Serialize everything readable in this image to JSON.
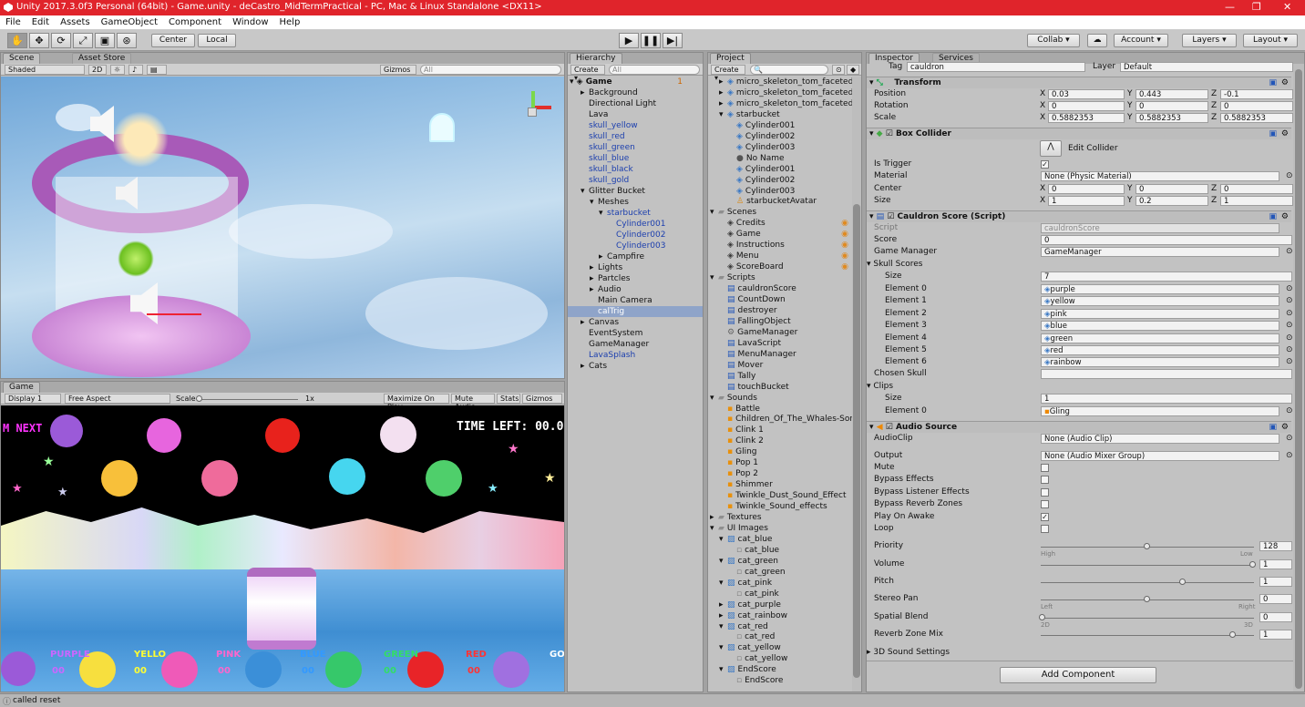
{
  "window": {
    "title": "Unity 2017.3.0f3 Personal (64bit) - Game.unity - deCastro_MidTermPractical - PC, Mac & Linux Standalone <DX11>",
    "accent": "#e0242b"
  },
  "menu": [
    "File",
    "Edit",
    "Assets",
    "GameObject",
    "Component",
    "Window",
    "Help"
  ],
  "toolbar": {
    "center": "Center",
    "local": "Local",
    "collab": "Collab ▾",
    "account": "Account",
    "layers": "Layers",
    "layout": "Layout"
  },
  "scene": {
    "tab": "Scene",
    "tab2": "Asset Store",
    "shading": "Shaded",
    "mode2d": "2D",
    "gizmos": "Gizmos",
    "search": "All"
  },
  "game": {
    "tab": "Game",
    "display": "Display 1",
    "aspect": "Free Aspect",
    "scale_label": "Scale",
    "scale_val": "1x",
    "maximize": "Maximize On Play",
    "mute": "Mute Audio",
    "stats": "Stats",
    "gizmos": "Gizmos",
    "hud_next": "M NEXT",
    "hud_time": "TIME LEFT: 00.0",
    "labels": [
      "PURPLE",
      "YELLO",
      "PINK",
      "BLUE",
      "GREEN",
      "RED",
      "GO"
    ],
    "counts": [
      "00",
      "00",
      "00",
      "00",
      "00",
      "00"
    ]
  },
  "hierarchy": {
    "tab": "Hierarchy",
    "create": "Create",
    "search": "All",
    "root": "Game",
    "badge": "1",
    "items": [
      {
        "t": "Background",
        "ind": 1,
        "arrow": "▸",
        "c": "n"
      },
      {
        "t": "Directional Light",
        "ind": 1,
        "arrow": "",
        "c": "n"
      },
      {
        "t": "Lava",
        "ind": 1,
        "arrow": "",
        "c": "n"
      },
      {
        "t": "skull_yellow",
        "ind": 1,
        "arrow": "",
        "c": "b"
      },
      {
        "t": "skull_red",
        "ind": 1,
        "arrow": "",
        "c": "b"
      },
      {
        "t": "skull_green",
        "ind": 1,
        "arrow": "",
        "c": "b"
      },
      {
        "t": "skull_blue",
        "ind": 1,
        "arrow": "",
        "c": "b"
      },
      {
        "t": "skull_black",
        "ind": 1,
        "arrow": "",
        "c": "b"
      },
      {
        "t": "skull_gold",
        "ind": 1,
        "arrow": "",
        "c": "b"
      },
      {
        "t": "Glitter Bucket",
        "ind": 1,
        "arrow": "▾",
        "c": "n"
      },
      {
        "t": "Meshes",
        "ind": 2,
        "arrow": "▾",
        "c": "n"
      },
      {
        "t": "starbucket",
        "ind": 3,
        "arrow": "▾",
        "c": "b"
      },
      {
        "t": "Cylinder001",
        "ind": 4,
        "arrow": "",
        "c": "b"
      },
      {
        "t": "Cylinder002",
        "ind": 4,
        "arrow": "",
        "c": "b"
      },
      {
        "t": "Cylinder003",
        "ind": 4,
        "arrow": "",
        "c": "b"
      },
      {
        "t": "Campfire",
        "ind": 3,
        "arrow": "▸",
        "c": "n"
      },
      {
        "t": "Lights",
        "ind": 2,
        "arrow": "▸",
        "c": "n"
      },
      {
        "t": "Partcles",
        "ind": 2,
        "arrow": "▸",
        "c": "n"
      },
      {
        "t": "Audio",
        "ind": 2,
        "arrow": "▸",
        "c": "n"
      },
      {
        "t": "Main Camera",
        "ind": 2,
        "arrow": "",
        "c": "n"
      },
      {
        "t": "calTrig",
        "ind": 2,
        "arrow": "",
        "c": "s"
      },
      {
        "t": "Canvas",
        "ind": 1,
        "arrow": "▸",
        "c": "n"
      },
      {
        "t": "EventSystem",
        "ind": 1,
        "arrow": "",
        "c": "n"
      },
      {
        "t": "GameManager",
        "ind": 1,
        "arrow": "",
        "c": "n"
      },
      {
        "t": "LavaSplash",
        "ind": 1,
        "arrow": "",
        "c": "b"
      },
      {
        "t": "Cats",
        "ind": 1,
        "arrow": "▸",
        "c": "n"
      }
    ]
  },
  "project": {
    "tab": "Project",
    "create": "Create",
    "items": [
      {
        "t": "micro_skeleton_tom_faceted_",
        "ind": 1,
        "a": "▸",
        "i": "mesh"
      },
      {
        "t": "micro_skeleton_tom_faceted_",
        "ind": 1,
        "a": "▸",
        "i": "mesh"
      },
      {
        "t": "micro_skeleton_tom_faceted_",
        "ind": 1,
        "a": "▸",
        "i": "mesh"
      },
      {
        "t": "starbucket",
        "ind": 1,
        "a": "▾",
        "i": "mesh"
      },
      {
        "t": "Cylinder001",
        "ind": 2,
        "a": "",
        "i": "mesh"
      },
      {
        "t": "Cylinder002",
        "ind": 2,
        "a": "",
        "i": "mesh"
      },
      {
        "t": "Cylinder003",
        "ind": 2,
        "a": "",
        "i": "mesh"
      },
      {
        "t": "No Name",
        "ind": 2,
        "a": "",
        "i": "mat"
      },
      {
        "t": "Cylinder001",
        "ind": 2,
        "a": "",
        "i": "mesh"
      },
      {
        "t": "Cylinder002",
        "ind": 2,
        "a": "",
        "i": "mesh"
      },
      {
        "t": "Cylinder003",
        "ind": 2,
        "a": "",
        "i": "mesh"
      },
      {
        "t": "starbucketAvatar",
        "ind": 2,
        "a": "",
        "i": "avatar"
      },
      {
        "t": "Scenes",
        "ind": 0,
        "a": "▾",
        "i": "folder"
      },
      {
        "t": "Credits",
        "ind": 1,
        "a": "",
        "i": "scene"
      },
      {
        "t": "Game",
        "ind": 1,
        "a": "",
        "i": "scene"
      },
      {
        "t": "Instructions",
        "ind": 1,
        "a": "",
        "i": "scene"
      },
      {
        "t": "Menu",
        "ind": 1,
        "a": "",
        "i": "scene"
      },
      {
        "t": "ScoreBoard",
        "ind": 1,
        "a": "",
        "i": "scene"
      },
      {
        "t": "Scripts",
        "ind": 0,
        "a": "▾",
        "i": "folder"
      },
      {
        "t": "cauldronScore",
        "ind": 1,
        "a": "",
        "i": "script"
      },
      {
        "t": "CountDown",
        "ind": 1,
        "a": "",
        "i": "script"
      },
      {
        "t": "destroyer",
        "ind": 1,
        "a": "",
        "i": "script"
      },
      {
        "t": "FallingObject",
        "ind": 1,
        "a": "",
        "i": "script"
      },
      {
        "t": "GameManager",
        "ind": 1,
        "a": "",
        "i": "gear"
      },
      {
        "t": "LavaScript",
        "ind": 1,
        "a": "",
        "i": "script"
      },
      {
        "t": "MenuManager",
        "ind": 1,
        "a": "",
        "i": "script"
      },
      {
        "t": "Mover",
        "ind": 1,
        "a": "",
        "i": "script"
      },
      {
        "t": "Tally",
        "ind": 1,
        "a": "",
        "i": "script"
      },
      {
        "t": "touchBucket",
        "ind": 1,
        "a": "",
        "i": "script"
      },
      {
        "t": "Sounds",
        "ind": 0,
        "a": "▾",
        "i": "folder"
      },
      {
        "t": "Battle",
        "ind": 1,
        "a": "",
        "i": "audio"
      },
      {
        "t": "Children_Of_The_Whales-Sor",
        "ind": 1,
        "a": "",
        "i": "audio"
      },
      {
        "t": "Clink 1",
        "ind": 1,
        "a": "",
        "i": "audio"
      },
      {
        "t": "Clink 2",
        "ind": 1,
        "a": "",
        "i": "audio"
      },
      {
        "t": "Gling",
        "ind": 1,
        "a": "",
        "i": "audio"
      },
      {
        "t": "Pop 1",
        "ind": 1,
        "a": "",
        "i": "audio"
      },
      {
        "t": "Pop 2",
        "ind": 1,
        "a": "",
        "i": "audio"
      },
      {
        "t": "Shimmer",
        "ind": 1,
        "a": "",
        "i": "audio"
      },
      {
        "t": "Twinkle_Dust_Sound_Effect",
        "ind": 1,
        "a": "",
        "i": "audio"
      },
      {
        "t": "Twinkle_Sound_effects",
        "ind": 1,
        "a": "",
        "i": "audio"
      },
      {
        "t": "Textures",
        "ind": 0,
        "a": "▸",
        "i": "folder"
      },
      {
        "t": "UI Images",
        "ind": 0,
        "a": "▾",
        "i": "folder"
      },
      {
        "t": "cat_blue",
        "ind": 1,
        "a": "▾",
        "i": "img"
      },
      {
        "t": "cat_blue",
        "ind": 2,
        "a": "",
        "i": "sprite"
      },
      {
        "t": "cat_green",
        "ind": 1,
        "a": "▾",
        "i": "img"
      },
      {
        "t": "cat_green",
        "ind": 2,
        "a": "",
        "i": "sprite"
      },
      {
        "t": "cat_pink",
        "ind": 1,
        "a": "▾",
        "i": "img"
      },
      {
        "t": "cat_pink",
        "ind": 2,
        "a": "",
        "i": "sprite"
      },
      {
        "t": "cat_purple",
        "ind": 1,
        "a": "▸",
        "i": "img"
      },
      {
        "t": "cat_rainbow",
        "ind": 1,
        "a": "▸",
        "i": "img"
      },
      {
        "t": "cat_red",
        "ind": 1,
        "a": "▾",
        "i": "img"
      },
      {
        "t": "cat_red",
        "ind": 2,
        "a": "",
        "i": "sprite"
      },
      {
        "t": "cat_yellow",
        "ind": 1,
        "a": "▾",
        "i": "img"
      },
      {
        "t": "cat_yellow",
        "ind": 2,
        "a": "",
        "i": "sprite"
      },
      {
        "t": "EndScore",
        "ind": 1,
        "a": "▾",
        "i": "img"
      },
      {
        "t": "EndScore",
        "ind": 2,
        "a": "",
        "i": "sprite"
      }
    ]
  },
  "inspector": {
    "tab": "Inspector",
    "tab2": "Services",
    "tag_label": "Tag",
    "tag": "cauldron",
    "layer_label": "Layer",
    "layer": "Default",
    "transform": {
      "title": "Transform",
      "position": "Position",
      "rotation": "Rotation",
      "scale": "Scale",
      "px": "0.03",
      "py": "0.443",
      "pz": "-0.1",
      "rx": "0",
      "ry": "0",
      "rz": "0",
      "sx": "0.5882353",
      "sy": "0.5882353",
      "sz": "0.5882353"
    },
    "box": {
      "title": "Box Collider",
      "edit": "Edit Collider",
      "is_trigger": "Is Trigger",
      "material": "Material",
      "material_val": "None (Physic Material)",
      "center": "Center",
      "cx": "0",
      "cy": "0",
      "cz": "0",
      "size": "Size",
      "sx": "1",
      "sy": "0.2",
      "sz": "1"
    },
    "cauldron": {
      "title": "Cauldron Score (Script)",
      "script": "Script",
      "script_val": "cauldronScore",
      "score": "Score",
      "score_val": "0",
      "gm": "Game Manager",
      "gm_val": "GameManager",
      "skull": "Skull Scores",
      "size": "Size",
      "size_val": "7",
      "elements": [
        {
          "l": "Element 0",
          "v": "purple"
        },
        {
          "l": "Element 1",
          "v": "yellow"
        },
        {
          "l": "Element 2",
          "v": "pink"
        },
        {
          "l": "Element 3",
          "v": "blue"
        },
        {
          "l": "Element 4",
          "v": "green"
        },
        {
          "l": "Element 5",
          "v": "red"
        },
        {
          "l": "Element 6",
          "v": "rainbow"
        }
      ],
      "chosen": "Chosen Skull",
      "clips": "Clips",
      "clip_size_val": "1",
      "clip_el": "Element 0",
      "clip_val": "Gling"
    },
    "audio": {
      "title": "Audio Source",
      "clip": "AudioClip",
      "clip_val": "None (Audio Clip)",
      "output": "Output",
      "output_val": "None (Audio Mixer Group)",
      "mute": "Mute",
      "bypass": "Bypass Effects",
      "bypass_l": "Bypass Listener Effects",
      "bypass_r": "Bypass Reverb Zones",
      "play": "Play On Awake",
      "loop": "Loop",
      "priority": "Priority",
      "priority_val": "128",
      "high": "High",
      "low": "Low",
      "volume": "Volume",
      "volume_val": "1",
      "pitch": "Pitch",
      "pitch_val": "1",
      "stereo": "Stereo Pan",
      "stereo_val": "0",
      "left": "Left",
      "right": "Right",
      "spatial": "Spatial Blend",
      "spatial_val": "0",
      "d2": "2D",
      "d3": "3D",
      "reverb": "Reverb Zone Mix",
      "reverb_val": "1",
      "settings3d": "3D Sound Settings"
    },
    "add": "Add Component"
  },
  "status": "called reset"
}
